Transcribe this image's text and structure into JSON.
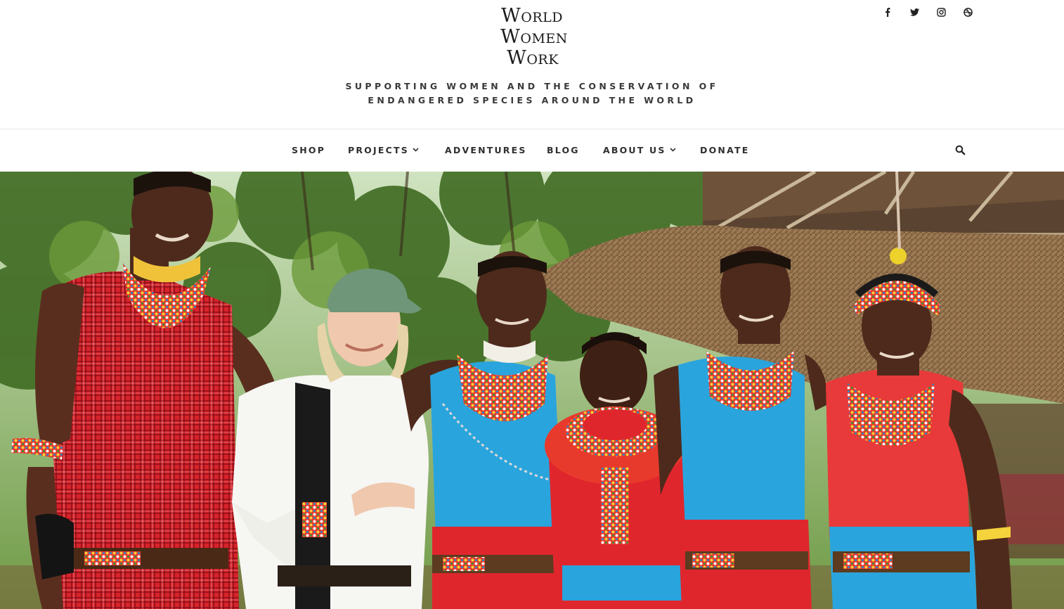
{
  "site": {
    "logo_lines": [
      "World",
      "Women",
      "Work"
    ],
    "tagline_line1": "SUPPORTING WOMEN AND THE CONSERVATION OF",
    "tagline_line2": "ENDANGERED SPECIES AROUND THE WORLD"
  },
  "social": [
    "facebook-icon",
    "twitter-icon",
    "instagram-icon",
    "dribbble-icon"
  ],
  "nav": {
    "items": [
      {
        "label": "SHOP",
        "has_dropdown": false
      },
      {
        "label": "PROJECTS",
        "has_dropdown": true
      },
      {
        "label": "ADVENTURES",
        "has_dropdown": false
      },
      {
        "label": "BLOG",
        "has_dropdown": false
      },
      {
        "label": "ABOUT US",
        "has_dropdown": true
      },
      {
        "label": "DONATE",
        "has_dropdown": false
      }
    ],
    "search_icon": "search-icon"
  },
  "hero": {
    "image": "group-photo",
    "colors": {
      "red": "#e0262d",
      "blue": "#2aa4dc",
      "foliage": "#4d7a2a",
      "thatch": "#8a6a45"
    }
  }
}
